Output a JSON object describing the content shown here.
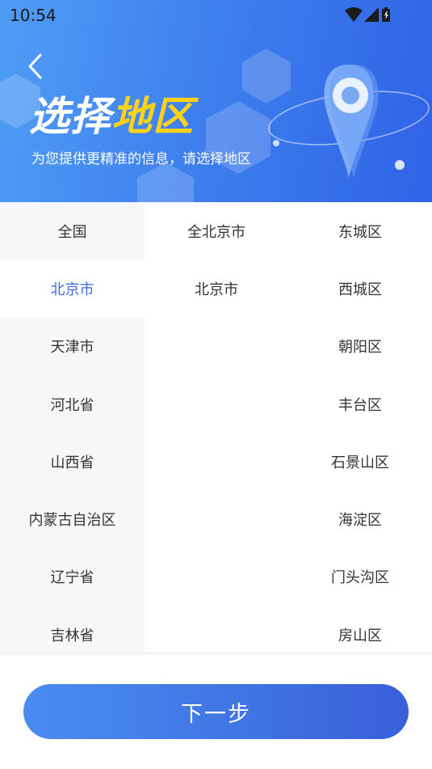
{
  "status_bar": {
    "time": "10:54"
  },
  "header": {
    "title_white": "选择",
    "title_yellow": "地区",
    "subtitle": "为您提供更精准的信息，请选择地区"
  },
  "provinces": [
    "全国",
    "北京市",
    "天津市",
    "河北省",
    "山西省",
    "内蒙古自治区",
    "辽宁省",
    "吉林省"
  ],
  "selected_province": "北京市",
  "cities": [
    "全北京市",
    "北京市"
  ],
  "districts": [
    "东城区",
    "西城区",
    "朝阳区",
    "丰台区",
    "石景山区",
    "海淀区",
    "门头沟区",
    "房山区"
  ],
  "footer": {
    "next_label": "下一步"
  },
  "colors": {
    "accent": "#3f6bd9",
    "title_highlight": "#ffd21a",
    "header_start": "#4f9df5",
    "header_end": "#2f63e6"
  }
}
